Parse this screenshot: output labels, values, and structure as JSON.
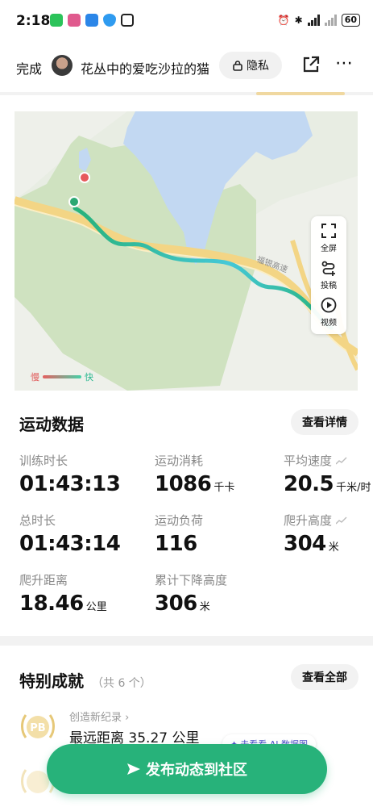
{
  "status_bar": {
    "time": "2:18",
    "battery": "60"
  },
  "header": {
    "done_label": "完成",
    "title": "花丛中的爱吃沙拉的猫",
    "privacy_label": "隐私",
    "share_icon": "share-icon",
    "more_icon": "more-icon"
  },
  "map": {
    "road_label": "福银高速",
    "tools": [
      {
        "label": "全屏",
        "icon": "fullscreen-icon"
      },
      {
        "label": "投稿",
        "icon": "route-icon"
      },
      {
        "label": "视频",
        "icon": "play-icon"
      }
    ],
    "legend": {
      "slow": "慢",
      "fast": "快"
    },
    "colors": {
      "water": "#c2d8f2",
      "forest": "#cfe2c0",
      "road": "#f3d585",
      "track_start": "#27b27a",
      "track_end": "#45c8d8"
    }
  },
  "workout": {
    "title": "运动数据",
    "details_button": "查看详情",
    "metrics": [
      {
        "label": "训练时长",
        "value": "01:43:13",
        "unit": ""
      },
      {
        "label": "运动消耗",
        "value": "1086",
        "unit": "千卡"
      },
      {
        "label": "平均速度",
        "value": "20.5",
        "unit": "千米/时"
      },
      {
        "label": "总时长",
        "value": "01:43:14",
        "unit": ""
      },
      {
        "label": "运动负荷",
        "value": "116",
        "unit": ""
      },
      {
        "label": "爬升高度",
        "value": "304",
        "unit": "米"
      },
      {
        "label": "爬升距离",
        "value": "18.46",
        "unit": "公里"
      },
      {
        "label": "累计下降高度",
        "value": "306",
        "unit": "米"
      }
    ]
  },
  "achievements": {
    "title": "特别成就",
    "count": "（共 6 个）",
    "view_all_button": "查看全部",
    "first": {
      "tag": "创造新纪录 ›",
      "text": "最远距离 35.27 公里",
      "badge": "PB"
    },
    "ai_chip": "去看看 AI 数据图"
  },
  "publish_button": "发布动态到社区"
}
